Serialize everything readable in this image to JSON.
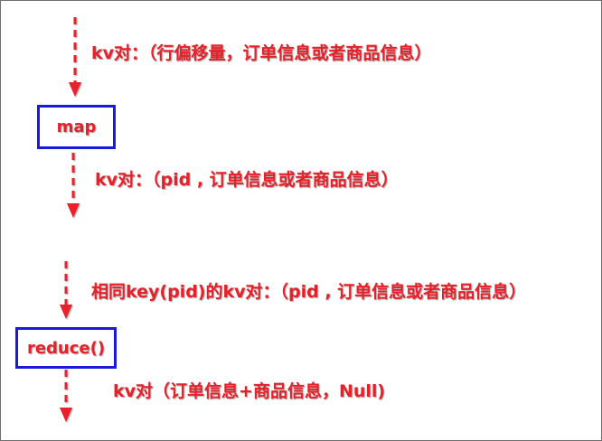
{
  "colors": {
    "text": "#e8202a",
    "box_border": "#1a1adc",
    "arrow": "#e8202a",
    "frame": "#6e6e6e"
  },
  "step1": {
    "label": "kv对：（行偏移量，订单信息或者商品信息）"
  },
  "map_box": {
    "label": "map"
  },
  "step2": {
    "label": "kv对：（pid , 订单信息或者商品信息）"
  },
  "step3": {
    "label": "相同key(pid)的kv对：（pid , 订单信息或者商品信息）"
  },
  "reduce_box": {
    "label": "reduce()"
  },
  "step4": {
    "label": "kv对（订单信息+商品信息，Null)"
  }
}
